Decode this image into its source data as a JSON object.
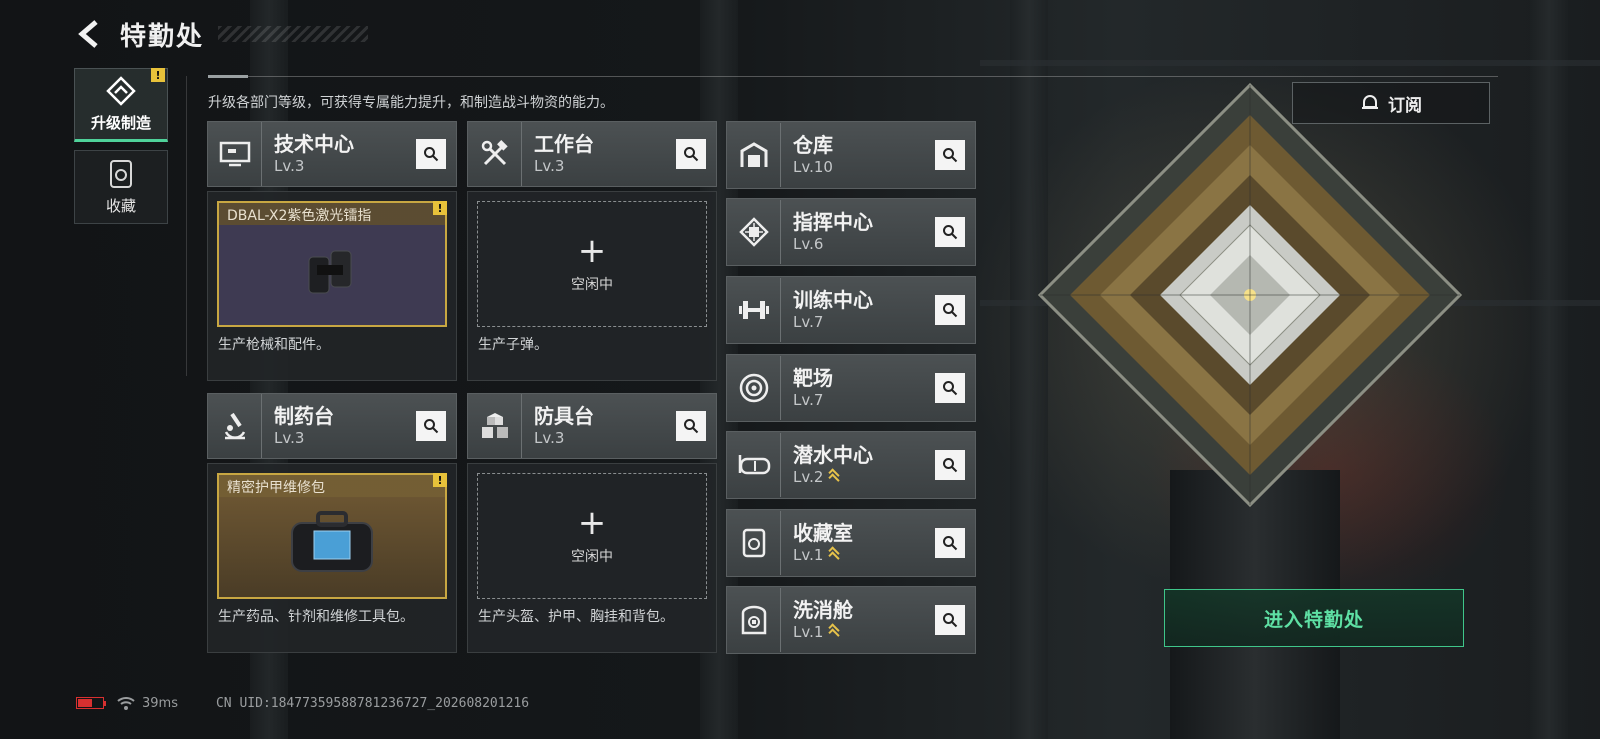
{
  "header": {
    "title": "特勤处"
  },
  "nav": {
    "items": [
      {
        "label": "升级制造",
        "active": true,
        "warning": "!"
      },
      {
        "label": "收藏",
        "active": false
      }
    ]
  },
  "intro_text": "升级各部门等级，可获得专属能力提升，和制造战斗物资的能力。",
  "subscribe_label": "订阅",
  "modules": [
    {
      "name": "技术中心",
      "level": "Lv.3",
      "icon": "monitor-icon",
      "slot": {
        "state": "busy",
        "item": "DBAL-X2紫色激光镭指",
        "warning": "!"
      },
      "description": "生产枪械和配件。"
    },
    {
      "name": "工作台",
      "level": "Lv.3",
      "icon": "tools-icon",
      "slot": {
        "state": "idle",
        "plus": "+",
        "status": "空闲中"
      },
      "description": "生产子弹。"
    },
    {
      "name": "制药台",
      "level": "Lv.3",
      "icon": "microscope-icon",
      "slot": {
        "state": "busy",
        "item": "精密护甲维修包",
        "warning": "!"
      },
      "description": "生产药品、针剂和维修工具包。"
    },
    {
      "name": "防具台",
      "level": "Lv.3",
      "icon": "blocks-icon",
      "slot": {
        "state": "idle",
        "plus": "+",
        "status": "空闲中"
      },
      "description": "生产头盔、护甲、胸挂和背包。"
    }
  ],
  "facilities": [
    {
      "name": "仓库",
      "level": "Lv.10",
      "icon": "warehouse-icon",
      "upgradable": false
    },
    {
      "name": "指挥中心",
      "level": "Lv.6",
      "icon": "chip-icon",
      "upgradable": false
    },
    {
      "name": "训练中心",
      "level": "Lv.7",
      "icon": "dumbbell-icon",
      "upgradable": false
    },
    {
      "name": "靶场",
      "level": "Lv.7",
      "icon": "target-icon",
      "upgradable": false
    },
    {
      "name": "潜水中心",
      "level": "Lv.2",
      "icon": "diving-mask-icon",
      "upgradable": true
    },
    {
      "name": "收藏室",
      "level": "Lv.1",
      "icon": "collection-icon",
      "upgradable": true
    },
    {
      "name": "洗消舱",
      "level": "Lv.1",
      "icon": "decontamination-icon",
      "upgradable": true
    }
  ],
  "enter_button": "进入特勤处",
  "status": {
    "ping": "39ms",
    "uid": "CN UID:18477359588781236727_202608201216"
  },
  "colors": {
    "accent_green": "#4fd29a",
    "warning_yellow": "#e8c23a",
    "level_up_gold": "#e6c24a"
  }
}
